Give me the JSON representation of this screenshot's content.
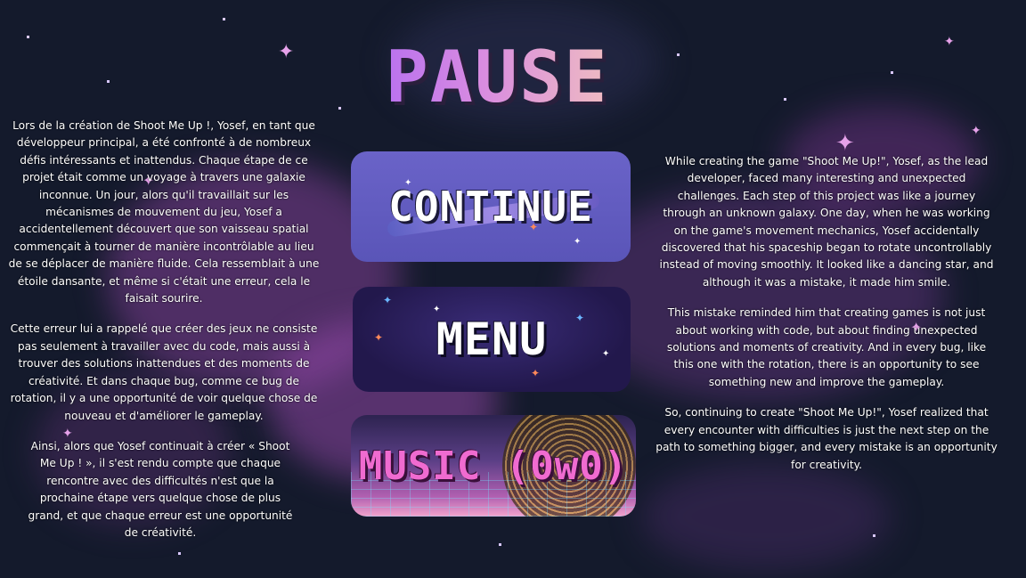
{
  "screen": {
    "title": "PAUSE",
    "background_color": "#141a2c",
    "accent_color": "#b36cf2"
  },
  "buttons": {
    "continue_label": "CONTINUE",
    "menu_label": "MENU",
    "music_label": "MUSIC (0w0)"
  },
  "story_fr": {
    "p1": "Lors de la création de Shoot Me Up !, Yosef, en tant que développeur principal, a été confronté à de nombreux défis intéressants et inattendus. Chaque étape de ce projet était comme un voyage à travers une galaxie inconnue. Un jour, alors qu'il travaillait sur les mécanismes de mouvement du jeu, Yosef a accidentellement découvert que son vaisseau spatial commençait à tourner de manière incontrôlable au lieu de se déplacer de manière fluide. Cela ressemblait à une étoile dansante, et même si c'était une erreur, cela le faisait sourire.",
    "p2": "Cette erreur lui a rappelé que créer des jeux ne consiste pas seulement à travailler avec du code, mais aussi à trouver des solutions inattendues et des moments de créativité. Et dans chaque bug, comme ce bug de rotation, il y a une opportunité de voir quelque chose de nouveau et d'améliorer le gameplay.",
    "p3": "Ainsi, alors que Yosef continuait à créer « Shoot Me Up ! », il s'est rendu compte que chaque rencontre avec des difficultés n'est que la prochaine étape vers quelque chose de plus grand, et que chaque erreur est une opportunité de créativité."
  },
  "story_en": {
    "p1": "While creating the game \"Shoot Me Up!\", Yosef, as the lead developer, faced many interesting and unexpected challenges. Each step of this project was like a journey through an unknown galaxy. One day, when he was working on the game's movement mechanics, Yosef accidentally discovered that his spaceship began to rotate uncontrollably instead of moving smoothly. It looked like a dancing star, and although it was a mistake, it made him smile.",
    "p2": "This mistake reminded him that creating games is not just about working with code, but about finding unexpected solutions and moments of creativity. And in every bug, like this one with the rotation, there is an opportunity to see something new and improve the gameplay.",
    "p3": "So, continuing to create \"Shoot Me Up!\", Yosef realized that every encounter with difficulties is just the next step on the path to something bigger, and every mistake is an opportunity for creativity."
  }
}
